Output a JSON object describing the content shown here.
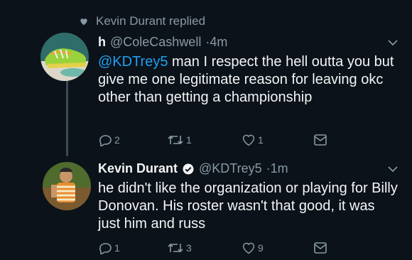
{
  "context": {
    "text": "Kevin Durant replied"
  },
  "tweets": [
    {
      "name": "h",
      "handle": "@ColeCashwell",
      "time": "4m",
      "mention": "@KDTrey5",
      "text": " man I respect the hell outta you but give me one legitimate reason for leaving okc other than getting a championship",
      "reply_count": "2",
      "retweet_count": "1",
      "like_count": "1"
    },
    {
      "name": "Kevin Durant",
      "handle": "@KDTrey5",
      "time": "1m",
      "text": "he didn't like the organization or playing for Billy Donovan. His roster wasn't that good, it was just him and russ",
      "reply_count": "1",
      "retweet_count": "3",
      "like_count": "9"
    }
  ],
  "colors": {
    "background": "#0c1219",
    "text_primary": "#f3f5f7",
    "text_secondary": "#8899a6",
    "mention": "#1da1f2",
    "verified": "#1da1f2"
  },
  "icons": {
    "context": "heart-icon",
    "reply": "reply-icon",
    "retweet": "retweet-icon",
    "like": "like-icon",
    "dm": "direct-message-icon",
    "menu": "chevron-down-icon",
    "verified": "verified-badge-icon"
  }
}
